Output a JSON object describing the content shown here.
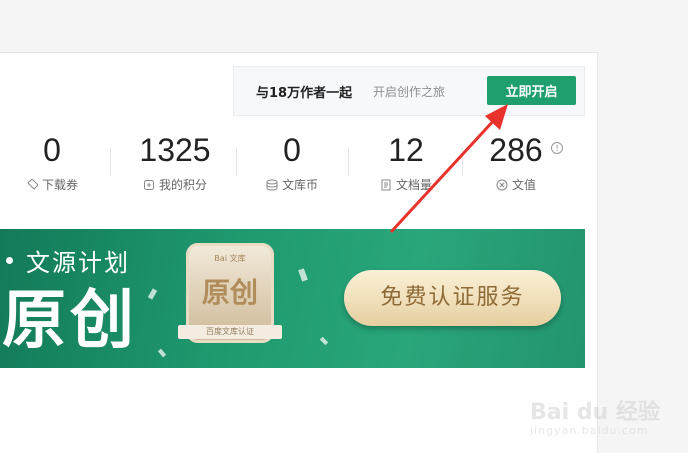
{
  "promo": {
    "title": "与18万作者一起",
    "subtitle": "开启创作之旅",
    "button": "立即开启"
  },
  "stats": [
    {
      "value": "0",
      "label": "下载券",
      "icon": "ticket-icon"
    },
    {
      "value": "1325",
      "label": "我的积分",
      "icon": "points-icon"
    },
    {
      "value": "0",
      "label": "文库币",
      "icon": "coin-stack-icon"
    },
    {
      "value": "12",
      "label": "文档量",
      "icon": "document-icon"
    },
    {
      "value": "286",
      "label": "文值",
      "icon": "value-icon"
    }
  ],
  "info_mark": "!",
  "banner": {
    "title": "文源计划",
    "big_text": "原创",
    "badge_brand": "Bai 文库",
    "badge_text": "原创",
    "badge_ribbon": "百度文库认证",
    "button": "免费认证服务"
  },
  "watermark": {
    "brand": "Bai du 经验",
    "url": "jingyan.baidu.com"
  },
  "colors": {
    "accent": "#1f9e6e",
    "arrow": "#e8322b"
  }
}
